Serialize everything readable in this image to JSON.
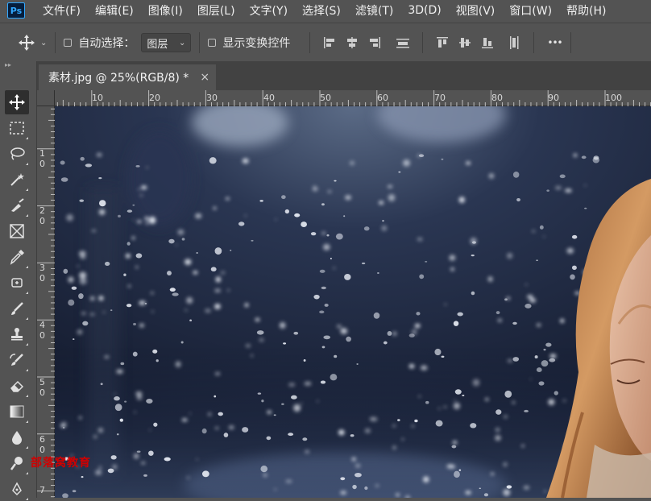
{
  "app": {
    "logo": "Ps"
  },
  "menu": [
    {
      "label": "文件(F)"
    },
    {
      "label": "编辑(E)"
    },
    {
      "label": "图像(I)"
    },
    {
      "label": "图层(L)"
    },
    {
      "label": "文字(Y)"
    },
    {
      "label": "选择(S)"
    },
    {
      "label": "滤镜(T)"
    },
    {
      "label": "3D(D)"
    },
    {
      "label": "视图(V)"
    },
    {
      "label": "窗口(W)"
    },
    {
      "label": "帮助(H)"
    }
  ],
  "options": {
    "auto_select_label": "自动选择：",
    "auto_select_target": "图层",
    "show_transform_label": "显示变换控件",
    "more_label": "•••"
  },
  "document": {
    "tab_title": "素材.jpg @ 25%(RGB/8) *",
    "close_glyph": "×"
  },
  "ruler": {
    "top_labels": [
      "10",
      "20",
      "30",
      "40",
      "50",
      "60",
      "70",
      "80",
      "90",
      "100"
    ],
    "left_labels": [
      "1\n0",
      "2\n0",
      "3\n0",
      "4\n0",
      "5\n0",
      "6\n0",
      "7"
    ]
  },
  "watermark": {
    "text": "部落窝教育"
  },
  "colors": {
    "ps_blue": "#31a8ff",
    "ui_gray": "#535353",
    "watermark": "#d10000"
  }
}
